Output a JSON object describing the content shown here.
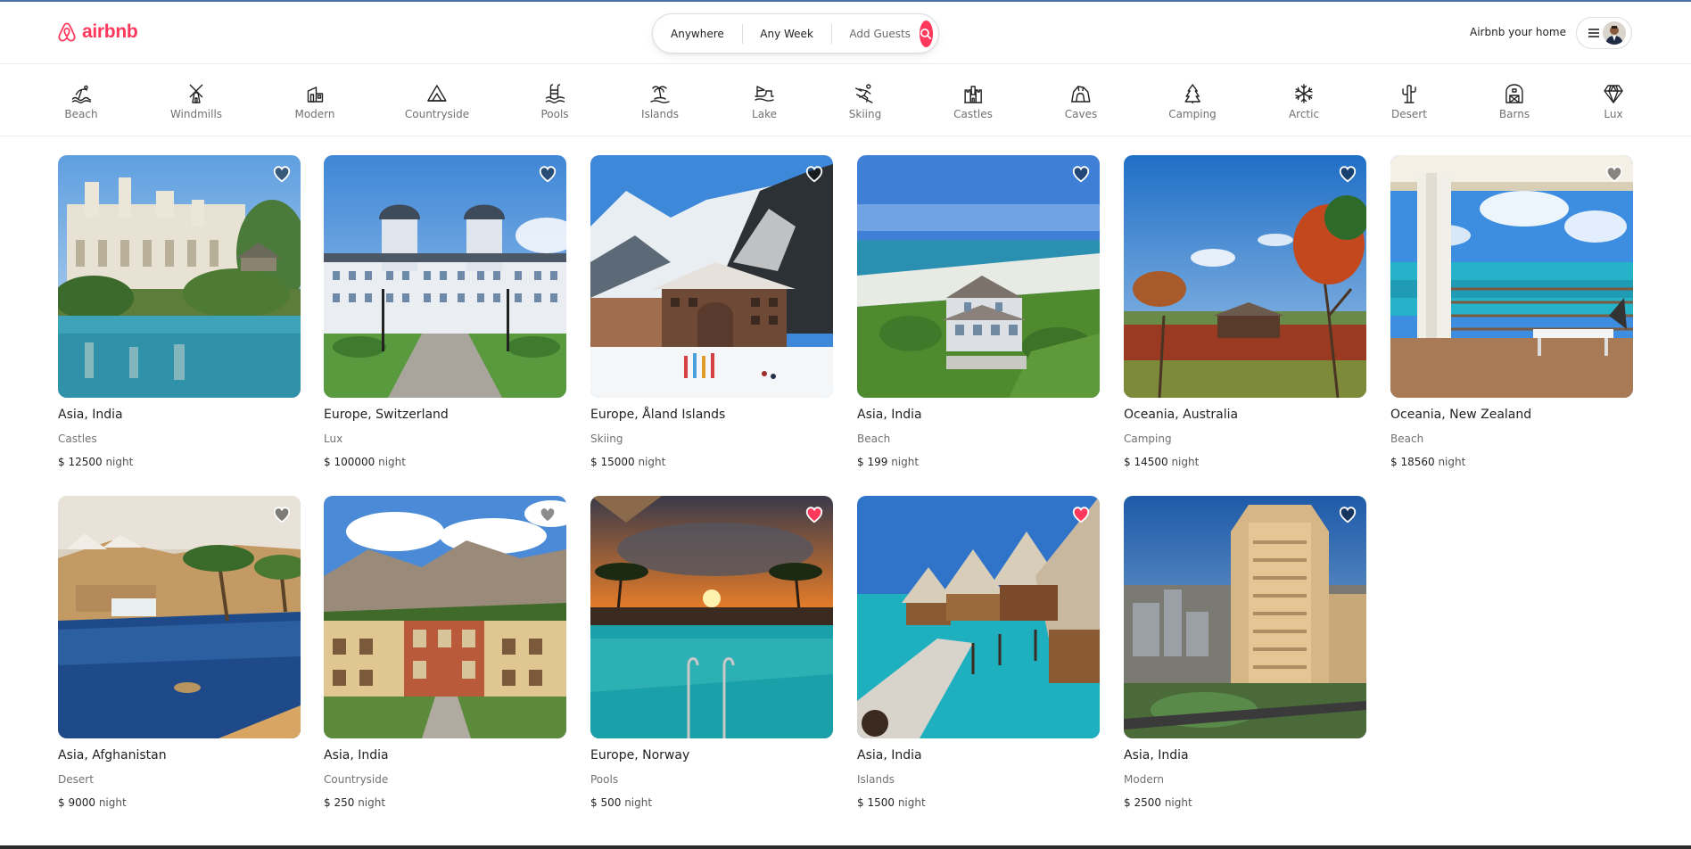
{
  "brand": {
    "name": "airbnb",
    "color": "#ff385c"
  },
  "search": {
    "where": "Anywhere",
    "when": "Any Week",
    "guests": "Add Guests",
    "button_icon": "search-icon"
  },
  "header": {
    "host_link": "Airbnb your home",
    "menu_icon": "hamburger-menu-icon",
    "avatar_icon": "user-avatar"
  },
  "categories": [
    {
      "label": "Beach",
      "icon": "beach-icon"
    },
    {
      "label": "Windmills",
      "icon": "windmill-icon"
    },
    {
      "label": "Modern",
      "icon": "modern-house-icon"
    },
    {
      "label": "Countryside",
      "icon": "countryside-icon"
    },
    {
      "label": "Pools",
      "icon": "pool-icon"
    },
    {
      "label": "Islands",
      "icon": "island-icon"
    },
    {
      "label": "Lake",
      "icon": "lake-icon"
    },
    {
      "label": "Skiing",
      "icon": "skiing-icon"
    },
    {
      "label": "Castles",
      "icon": "castle-icon"
    },
    {
      "label": "Caves",
      "icon": "cave-icon"
    },
    {
      "label": "Camping",
      "icon": "camping-icon"
    },
    {
      "label": "Arctic",
      "icon": "snowflake-icon"
    },
    {
      "label": "Desert",
      "icon": "cactus-icon"
    },
    {
      "label": "Barns",
      "icon": "barn-icon"
    },
    {
      "label": "Lux",
      "icon": "diamond-icon"
    }
  ],
  "price_unit": "night",
  "listings": [
    {
      "location": "Asia, India",
      "category": "Castles",
      "price": "$ 12500",
      "favorited": false,
      "scene": "palace"
    },
    {
      "location": "Europe, Switzerland",
      "category": "Lux",
      "price": "$ 100000",
      "favorited": false,
      "scene": "grand-hotel"
    },
    {
      "location": "Europe, Åland Islands",
      "category": "Skiing",
      "price": "$ 15000",
      "favorited": false,
      "scene": "ski-lodge"
    },
    {
      "location": "Asia, India",
      "category": "Beach",
      "price": "$ 199",
      "favorited": false,
      "scene": "beach-house"
    },
    {
      "location": "Oceania, Australia",
      "category": "Camping",
      "price": "$ 14500",
      "favorited": false,
      "scene": "outback-tent"
    },
    {
      "location": "Oceania, New Zealand",
      "category": "Beach",
      "price": "$ 18560",
      "favorited": false,
      "scene": "sea-balcony"
    },
    {
      "location": "Asia, Afghanistan",
      "category": "Desert",
      "price": "$ 9000",
      "favorited": false,
      "scene": "desert-oasis"
    },
    {
      "location": "Asia, India",
      "category": "Countryside",
      "price": "$ 250",
      "favorited": false,
      "scene": "mountain-lodge"
    },
    {
      "location": "Europe, Norway",
      "category": "Pools",
      "price": "$ 500",
      "favorited": true,
      "scene": "sunset-pool"
    },
    {
      "location": "Asia, India",
      "category": "Islands",
      "price": "$ 1500",
      "favorited": true,
      "scene": "water-villas"
    },
    {
      "location": "Asia, India",
      "category": "Modern",
      "price": "$ 2500",
      "favorited": false,
      "scene": "city-tower"
    }
  ]
}
